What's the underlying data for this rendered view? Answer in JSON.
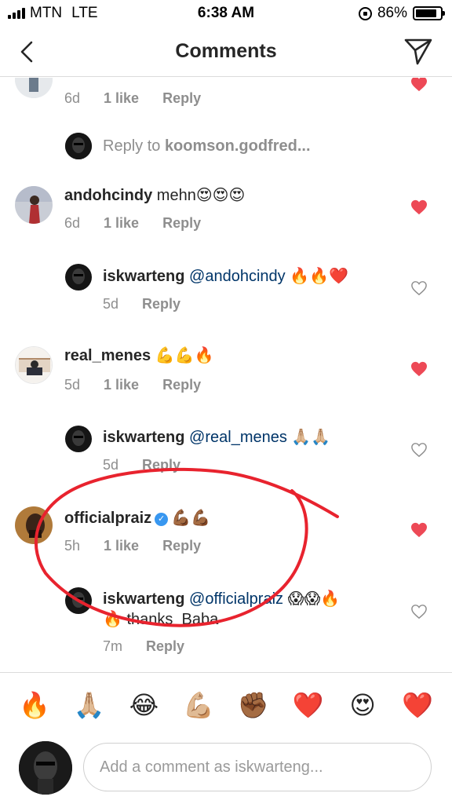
{
  "status_bar": {
    "carrier": "MTN",
    "network": "LTE",
    "time": "6:38 AM",
    "battery": "86%",
    "battery_level": 0.86
  },
  "header": {
    "title": "Comments",
    "back_icon": "chevron-left-icon",
    "send_icon": "paper-plane-icon"
  },
  "comments": [
    {
      "meta_age": "6d",
      "meta_likes": "1 like",
      "meta_reply": "Reply",
      "liked": true,
      "view_reply": {
        "prefix": "Reply to ",
        "user": "koomson.godfred..."
      }
    },
    {
      "user": "andohcindy",
      "text": "mehn",
      "emoji": "😍😍😍",
      "meta_age": "6d",
      "meta_likes": "1 like",
      "meta_reply": "Reply",
      "liked": true,
      "reply": {
        "user": "iskwarteng",
        "mention": "@andohcindy",
        "emoji": "🔥🔥❤️",
        "meta_age": "5d",
        "meta_reply": "Reply",
        "liked": false
      }
    },
    {
      "user": "real_menes",
      "emoji": "💪💪🔥",
      "meta_age": "5d",
      "meta_likes": "1 like",
      "meta_reply": "Reply",
      "liked": true,
      "reply": {
        "user": "iskwarteng",
        "mention": "@real_menes",
        "emoji": "🙏🏼🙏🏼",
        "meta_age": "5d",
        "meta_reply": "Reply",
        "liked": false
      }
    },
    {
      "user": "officialpraiz",
      "verified": true,
      "emoji": "💪🏾💪🏾",
      "meta_age": "5h",
      "meta_likes": "1 like",
      "meta_reply": "Reply",
      "liked": true,
      "reply": {
        "user": "iskwarteng",
        "mention": "@officialpraiz",
        "emoji": "😱😱🔥",
        "line2_emoji": "🔥",
        "line2_text": "thanks  Baba",
        "meta_age": "7m",
        "meta_reply": "Reply",
        "liked": false
      }
    }
  ],
  "emoji_bar": [
    "🔥",
    "🙏🏼",
    "😂",
    "💪🏼",
    "✊🏾",
    "❤️",
    "😍",
    "❤️"
  ],
  "compose": {
    "placeholder": "Add a comment as iskwarteng..."
  },
  "colors": {
    "heart_red": "#ed4956",
    "annotation_red": "#e8232e",
    "mention_blue": "#003569",
    "meta_gray": "#8e8e8e",
    "verified_blue": "#3897f0"
  }
}
